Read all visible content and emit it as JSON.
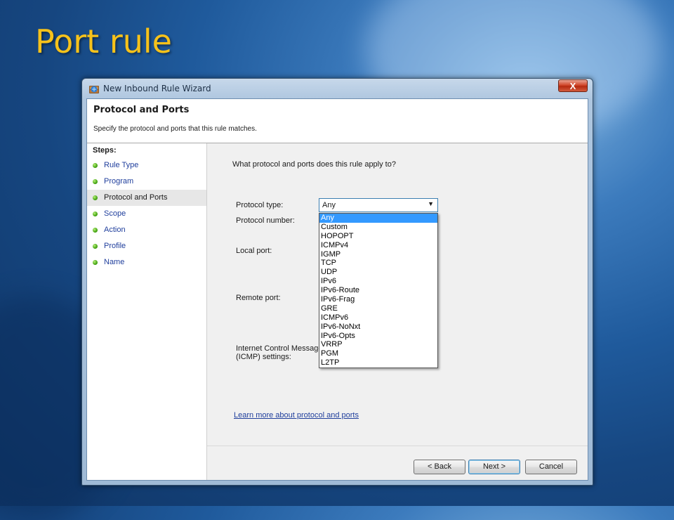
{
  "slide": {
    "title": "Port rule"
  },
  "window": {
    "title": "New Inbound Rule Wizard",
    "icon": "firewall-shield-icon",
    "close_icon": "close-x-icon",
    "close_glyph": "X"
  },
  "header": {
    "title": "Protocol and Ports",
    "description": "Specify the protocol and ports that this rule matches."
  },
  "steps": {
    "label": "Steps:",
    "items": [
      {
        "label": "Rule Type"
      },
      {
        "label": "Program"
      },
      {
        "label": "Protocol and Ports",
        "current": true
      },
      {
        "label": "Scope"
      },
      {
        "label": "Action"
      },
      {
        "label": "Profile"
      },
      {
        "label": "Name"
      }
    ]
  },
  "main": {
    "question": "What protocol and ports does this rule apply to?",
    "protocol_type_label": "Protocol type:",
    "protocol_number_label": "Protocol number:",
    "local_port_label": "Local port:",
    "remote_port_label": "Remote port:",
    "icmp_label_line1": "Internet Control Message",
    "icmp_label_line2": "(ICMP) settings:",
    "protocol_select": {
      "value": "Any",
      "options": [
        "Any",
        "Custom",
        "HOPOPT",
        "ICMPv4",
        "IGMP",
        "TCP",
        "UDP",
        "IPv6",
        "IPv6-Route",
        "IPv6-Frag",
        "GRE",
        "ICMPv6",
        "IPv6-NoNxt",
        "IPv6-Opts",
        "VRRP",
        "PGM",
        "L2TP"
      ],
      "highlighted": "Any"
    },
    "learn_more_link": "Learn more about protocol and ports"
  },
  "footer": {
    "back_label": "< Back",
    "next_label": "Next >",
    "cancel_label": "Cancel"
  },
  "colors": {
    "title_yellow": "#f6c21b",
    "link_blue": "#1f3e9c",
    "selection_blue": "#3399ff",
    "step_dot_green": "#45a514"
  }
}
